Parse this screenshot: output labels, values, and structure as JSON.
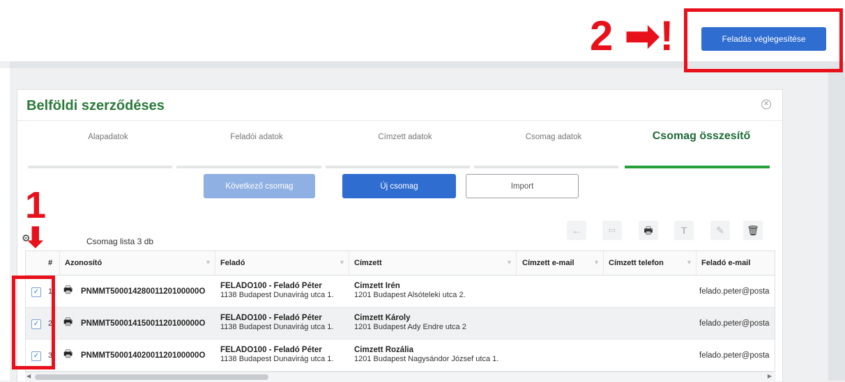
{
  "header": {
    "finalize_label": "Feladás véglegesítése"
  },
  "annotations": {
    "step2": "2",
    "step1": "1",
    "arrow_right": "➡",
    "exclaim": "!",
    "arrow_down": "⬇",
    "accent_color": "#e8101a"
  },
  "panel": {
    "title": "Belföldi szerződéses",
    "close_icon": "close-icon",
    "steps": [
      "Alapadatok",
      "Feladói adatok",
      "Címzett adatok",
      "Csomag adatok",
      "Csomag összesítő"
    ],
    "active_step": 4,
    "buttons": {
      "next": "Következő csomag",
      "new": "Új csomag",
      "import": "Import"
    },
    "toolbar_icons": [
      "back-arrow-icon",
      "card-icon",
      "print-icon",
      "text-icon",
      "edit-icon",
      "trash-icon"
    ]
  },
  "list": {
    "title": "Csomag lista  3 db",
    "columns": [
      "#",
      "Azonosító",
      "Feladó",
      "Címzett",
      "Címzett e-mail",
      "Címzett telefon",
      "Feladó e-mail"
    ],
    "rows": [
      {
        "no": "1",
        "id": "PNMMT50001428001120100000O",
        "sender_name": "FELADO100 - Feladó Péter",
        "sender_addr": "1138 Budapest Dunavirág utca 1.",
        "rcpt_name": "Cimzett Irén",
        "rcpt_addr": "1201 Budapest Alsóteleki utca 2.",
        "sender_email": "felado.peter@posta"
      },
      {
        "no": "2",
        "id": "PNMMT50001415001120100000O",
        "sender_name": "FELADO100 - Feladó Péter",
        "sender_addr": "1138 Budapest Dunavirág utca 1.",
        "rcpt_name": "Cimzett Károly",
        "rcpt_addr": "1201 Budapest Ady Endre utca 2",
        "sender_email": "felado.peter@posta"
      },
      {
        "no": "3",
        "id": "PNMMT50001402001120100000O",
        "sender_name": "FELADO100 - Feladó Péter",
        "sender_addr": "1138 Budapest Dunavirág utca 1.",
        "rcpt_name": "Cimzett Rozália",
        "rcpt_addr": "1201 Budapest Nagysándor József utca 1.",
        "sender_email": "felado.peter@posta"
      }
    ]
  },
  "colors": {
    "primary": "#2f6dd0",
    "primary_disabled": "#8fb0e2",
    "title_green": "#2a7a3a",
    "active_step_green": "#27a03b"
  }
}
